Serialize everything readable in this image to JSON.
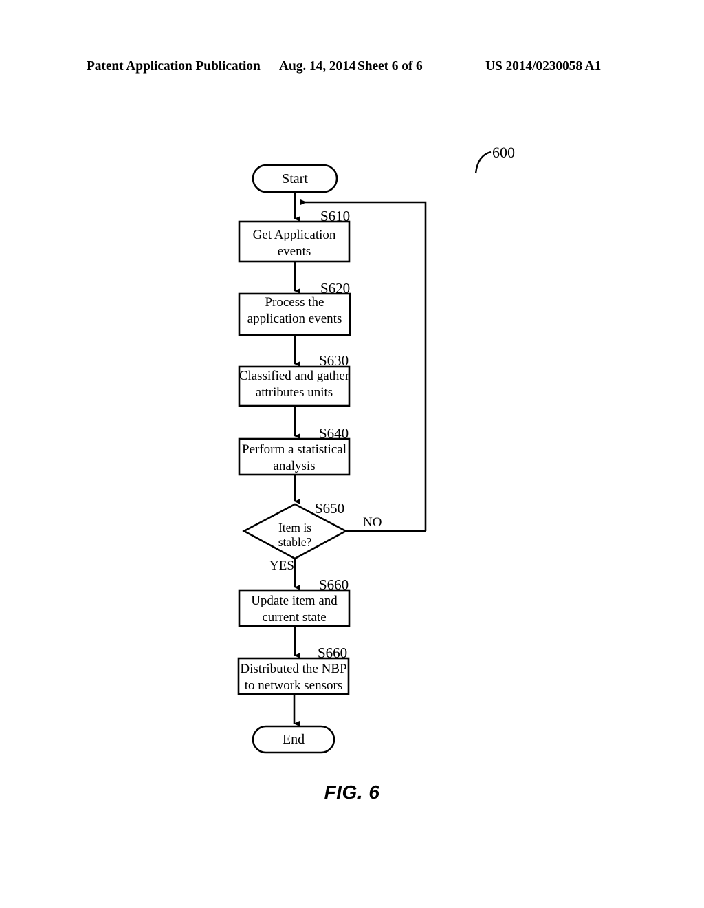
{
  "header": {
    "publication": "Patent Application Publication",
    "date": "Aug. 14, 2014",
    "sheet": "Sheet 6 of 6",
    "patent_number": "US 2014/0230058 A1"
  },
  "figure": {
    "caption": "FIG. 6",
    "reference_numeral": "600",
    "colors": {
      "stroke": "#000000",
      "fill": "#ffffff",
      "background": "#ffffff"
    }
  },
  "flowchart": {
    "type": "flowchart",
    "nodes": [
      {
        "id": "start",
        "shape": "terminal",
        "label": "Start",
        "step": ""
      },
      {
        "id": "s610",
        "shape": "process",
        "label": "Get Application\nevents",
        "step": "S610"
      },
      {
        "id": "s620",
        "shape": "process",
        "label": "Process the\napplication events",
        "step": "S620"
      },
      {
        "id": "s630",
        "shape": "process",
        "label": "Classified and gather\nattributes units",
        "step": "S630"
      },
      {
        "id": "s640",
        "shape": "process",
        "label": "Perform a statistical\nanalysis",
        "step": "S640"
      },
      {
        "id": "s650",
        "shape": "decision",
        "label": "Item is\nstable?",
        "step": "S650"
      },
      {
        "id": "s660a",
        "shape": "process",
        "label": "Update item and\ncurrent state",
        "step": "S660"
      },
      {
        "id": "s660b",
        "shape": "process",
        "label": "Distributed the NBP\nto network sensors",
        "step": "S660"
      },
      {
        "id": "end",
        "shape": "terminal",
        "label": "End",
        "step": ""
      }
    ],
    "edges": [
      {
        "from": "start",
        "to": "s610",
        "label": ""
      },
      {
        "from": "s610",
        "to": "s620",
        "label": ""
      },
      {
        "from": "s620",
        "to": "s630",
        "label": ""
      },
      {
        "from": "s630",
        "to": "s640",
        "label": ""
      },
      {
        "from": "s640",
        "to": "s650",
        "label": ""
      },
      {
        "from": "s650",
        "to": "s660a",
        "label": "YES"
      },
      {
        "from": "s650",
        "to": "s610",
        "label": "NO"
      },
      {
        "from": "s660a",
        "to": "s660b",
        "label": ""
      },
      {
        "from": "s660b",
        "to": "end",
        "label": ""
      }
    ],
    "edge_labels": {
      "yes": "YES",
      "no": "NO"
    }
  }
}
